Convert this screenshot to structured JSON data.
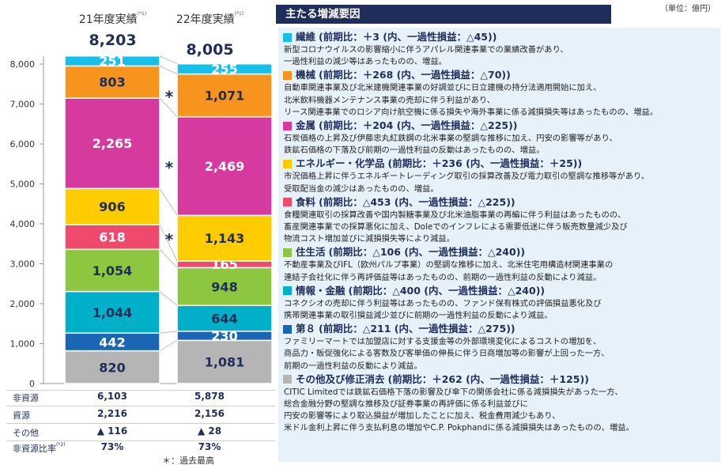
{
  "unit_label": "（単位：億円）",
  "panel_title": "主たる増減要因",
  "columns": [
    {
      "year_label": "21年度実績",
      "note": "(*1)",
      "total": "8,203"
    },
    {
      "year_label": "22年度実績",
      "note": "(*1)",
      "total": "8,005"
    }
  ],
  "chart_data": {
    "type": "bar",
    "stacked": true,
    "categories": [
      "21年度実績",
      "22年度実績"
    ],
    "ylim": [
      0,
      8000
    ],
    "yticks": [
      "0",
      "1,000",
      "2,000",
      "3,000",
      "4,000",
      "5,000",
      "6,000",
      "7,000",
      "8,000"
    ],
    "ytick_values": [
      0,
      1000,
      2000,
      3000,
      4000,
      5000,
      6000,
      7000,
      8000
    ],
    "totals": [
      8203,
      8005
    ],
    "series": [
      {
        "key": "dai8",
        "values": [
          820,
          1081
        ],
        "labels": [
          "820",
          "1,081"
        ],
        "color": "#b5b5b5",
        "text_color": "#1f2d5a"
      },
      {
        "key": "daihachi_blue",
        "values": [
          442,
          230
        ],
        "labels": [
          "442",
          "230"
        ],
        "color": "#1b66b4",
        "text_color": "#ffffff"
      },
      {
        "key": "joho_kinyu",
        "values": [
          1044,
          644
        ],
        "labels": [
          "1,044",
          "644"
        ],
        "color": "#00b0c8",
        "text_color": "#1f2d5a"
      },
      {
        "key": "jyuseikatsu",
        "values": [
          1054,
          948
        ],
        "labels": [
          "1,054",
          "948"
        ],
        "color": "#8dc63f",
        "text_color": "#1f2d5a"
      },
      {
        "key": "shokuryo",
        "values": [
          618,
          165
        ],
        "labels": [
          "618",
          "165"
        ],
        "color": "#ef4a6b",
        "text_color": "#ffffff"
      },
      {
        "key": "energy_chemicals",
        "values": [
          906,
          1143
        ],
        "labels": [
          "906",
          "1,143"
        ],
        "color": "#ffcc00",
        "text_color": "#1f2d5a"
      },
      {
        "key": "kinzoku",
        "values": [
          2265,
          2469
        ],
        "labels": [
          "2,265",
          "2,469"
        ],
        "color": "#d63a9f",
        "text_color": "#ffffff"
      },
      {
        "key": "kikai",
        "values": [
          803,
          1071
        ],
        "labels": [
          "803",
          "1,071"
        ],
        "color": "#f7941d",
        "text_color": "#1f2d5a"
      },
      {
        "key": "seni",
        "values": [
          251,
          255
        ],
        "labels": [
          "251",
          "255"
        ],
        "color": "#17c0e8",
        "text_color": "#ffffff"
      }
    ],
    "record_high_marks": [
      {
        "column": 1,
        "series": "kikai",
        "mark": "*"
      },
      {
        "column": 1,
        "series": "kinzoku",
        "mark": "*"
      },
      {
        "column": 1,
        "series": "energy_chemicals",
        "mark": "*"
      }
    ]
  },
  "table": [
    {
      "label": "非資源",
      "note": "",
      "v21": "6,103",
      "v22": "5,878"
    },
    {
      "label": "資源",
      "note": "",
      "v21": "2,216",
      "v22": "2,156"
    },
    {
      "label": "その他",
      "note": "",
      "v21": "▲ 116",
      "v22": "▲ 28"
    },
    {
      "label": "非資源比率",
      "note": "(*2)",
      "v21": "73%",
      "v22": "73%"
    }
  ],
  "footnote": "＊：過去最高",
  "segments": [
    {
      "color": "#17c0e8",
      "name": "繊維",
      "compare": "(前期比：＋3 (内、一過性損益：△45))",
      "lines": [
        "新型コロナウイルスの影響縮小に伴うアパレル関連事業での業績改善があり、",
        "一過性利益の減少等はあったものの、増益。"
      ]
    },
    {
      "color": "#f7941d",
      "name": "機械",
      "compare": "(前期比：＋268 (内、一過性損益：△70))",
      "lines": [
        "自動車関連事業及び北米建機関連事業の好調並びに日立建機の持分法適用開始に加え、",
        "北米飲料機器メンテナンス事業の売却に伴う利益があり、",
        "リース関連事業でのロシア向け航空機に係る損失や海外事業に係る減損損失等はあったものの、増益。"
      ]
    },
    {
      "color": "#d63a9f",
      "name": "金属",
      "compare": "(前期比：＋204 (内、一過性損益：△225))",
      "lines": [
        "石炭価格の上昇及び伊藤忠丸紅鉄鋼の北米事業の堅調な推移に加え、円安の影響等があり、",
        "鉄鉱石価格の下落及び前期の一過性利益の反動はあったものの、増益。"
      ]
    },
    {
      "color": "#ffcc00",
      "name": "エネルギー・化学品",
      "compare": "(前期比：＋236 (内、一過性損益：＋25))",
      "lines": [
        "市況価格上昇に伴うエネルギートレーディング取引の採算改善及び電力取引の堅調な推移等があり、",
        "受取配当金の減少はあったものの、増益。"
      ]
    },
    {
      "color": "#ef4a6b",
      "name": "食料",
      "compare": "(前期比：△453 (内、一過性損益：△225))",
      "lines": [
        "食糧関連取引の採算改善や国内製糖事業及び北米油脂事業の再編に伴う利益はあったものの、",
        "畜産関連事業での採算悪化に加え、Doleでのインフレによる需要低迷に伴う販売数量減少及び",
        "物流コスト増加並びに減損損失等により減益。"
      ]
    },
    {
      "color": "#8dc63f",
      "name": "住生活",
      "compare": "(前期比：△106 (内、一過性損益：△240))",
      "lines": [
        "不動産事業及びIFL（欧州パルプ事業）の堅調な推移に加え、北米住宅用構造材関連事業の",
        "連結子会社化に伴う再評価益等はあったものの、前期の一過性利益の反動により減益。"
      ]
    },
    {
      "color": "#00b0c8",
      "name": "情報・金融",
      "compare": "(前期比：△400 (内、一過性損益：△240))",
      "lines": [
        "コネクシオの売却に伴う利益等はあったものの、ファンド保有株式の評価損益悪化及び",
        "携帯関連事業の取引損益減少並びに前期の一過性利益の反動により減益。"
      ]
    },
    {
      "color": "#1b66b4",
      "name": "第８",
      "compare": "(前期比：△211 (内、一過性損益：△275))",
      "lines": [
        "ファミリーマートでは加盟店に対する支援金等の外部環境変化によるコストの増加を、",
        "商品力・販促強化による客数及び客単価の伸長に伴う日商増加等の影響が上回った一方、",
        "前期の一過性利益の反動により減益。"
      ]
    },
    {
      "color": "#b5b5b5",
      "name": "その他及び修正消去",
      "compare": "(前期比：＋262 (内、一過性損益：＋125))",
      "lines": [
        "CITIC Limitedでは鉄鉱石価格下落の影響及び傘下の関係会社に係る減損損失があった一方、",
        "総合金融分野の堅調な推移及び証券事業の再評価に係る利益並びに",
        "円安の影響等により取込損益が増加したことに加え、税金費用減少もあり、",
        "米ドル金利上昇に伴う支払利息の増加やC.P. Pokphandに係る減損損失はあったものの、増益。"
      ]
    }
  ]
}
